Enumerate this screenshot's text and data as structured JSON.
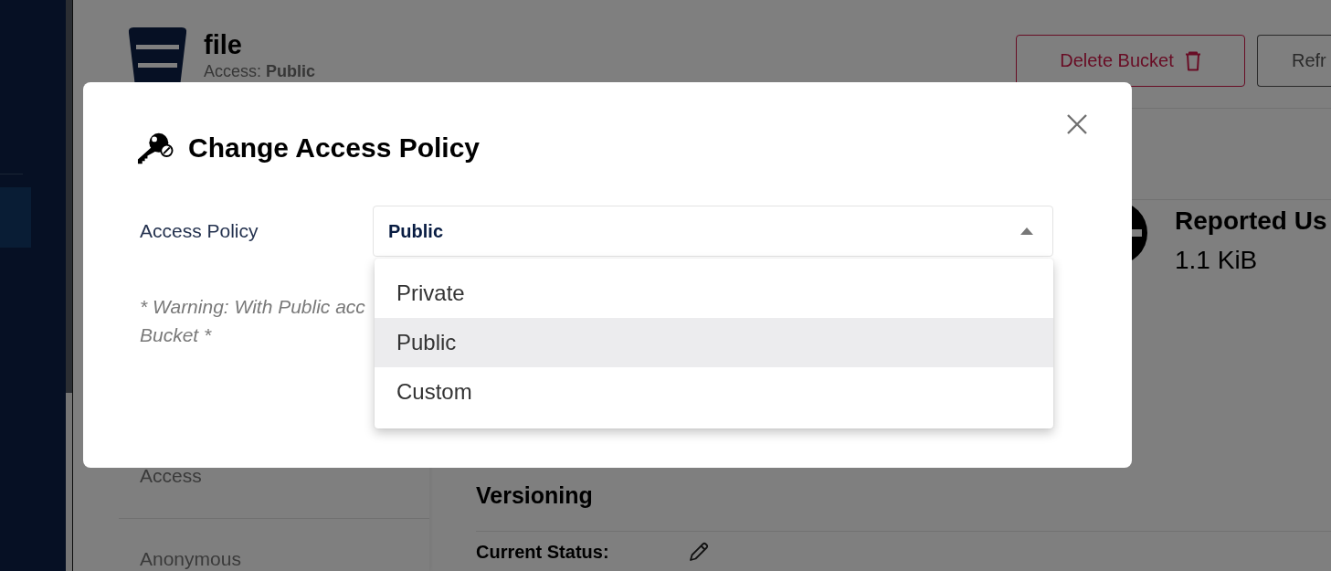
{
  "page": {
    "bucket": {
      "name": "file",
      "access": "Access: **Public**"
    },
    "buttons": [
      {
        "label": "Delete Bucket",
        "kind": "danger"
      },
      {
        "label": "Refr",
        "kind": "default"
      }
    ],
    "usage": {
      "title": "Reported Us",
      "value": "1.1 KiB"
    },
    "side_menu": {
      "items": [
        {
          "label": "Access"
        },
        {
          "label": "Anonymous"
        }
      ]
    },
    "versioning": {
      "title": "Versioning",
      "status_label": "Current Status:"
    }
  },
  "dialog": {
    "title": "Change Access Policy",
    "field": {
      "label": "Access Policy",
      "value": "Public",
      "expanded": true
    },
    "warning": [
      "* Warning: With Public acc",
      "Bucket *"
    ],
    "options": [
      {
        "label": "Private",
        "selected": false
      },
      {
        "label": "Public",
        "selected": true
      },
      {
        "label": "Custom",
        "selected": false
      }
    ]
  }
}
